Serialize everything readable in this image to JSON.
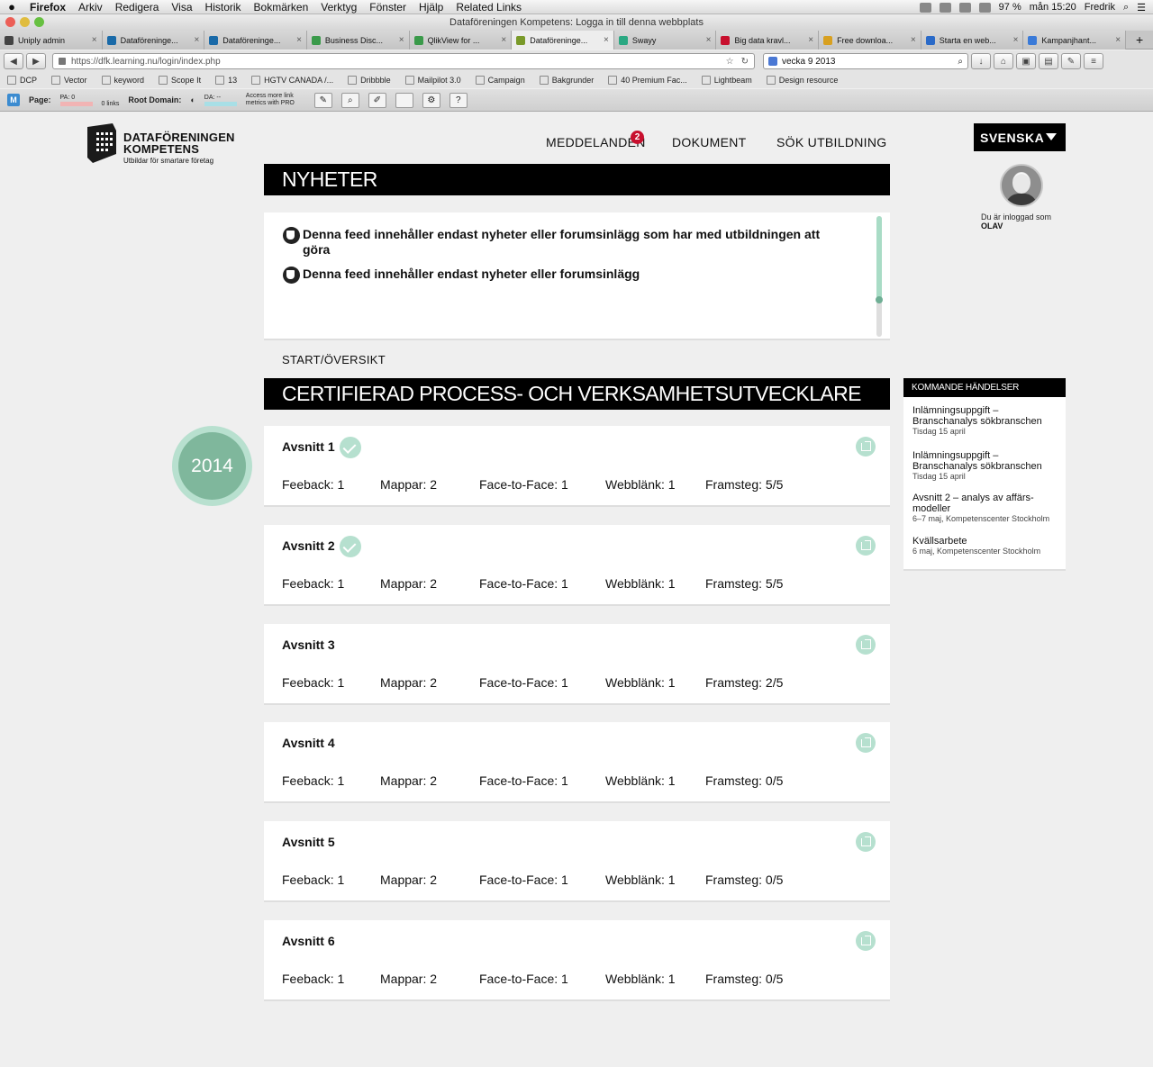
{
  "os_menu": {
    "app": "Firefox",
    "items": [
      "Arkiv",
      "Redigera",
      "Visa",
      "Historik",
      "Bokmärken",
      "Verktyg",
      "Fönster",
      "Hjälp",
      "Related Links"
    ],
    "battery": "97 %",
    "clock": "mån 15:20",
    "user": "Fredrik"
  },
  "window": {
    "title": "Dataföreningen Kompetens: Logga in till denna webbplats"
  },
  "tabs": [
    {
      "label": "Uniply admin",
      "color": "#444444"
    },
    {
      "label": "Dataföreninge...",
      "color": "#1a6aa8"
    },
    {
      "label": "Dataföreninge...",
      "color": "#1a6aa8"
    },
    {
      "label": "Business Disc...",
      "color": "#3a9a4a"
    },
    {
      "label": "QlikView for ...",
      "color": "#3a9a4a"
    },
    {
      "label": "Dataföreninge...",
      "color": "#7a9a2a",
      "active": true
    },
    {
      "label": "Swayy",
      "color": "#2aa882"
    },
    {
      "label": "Big data kravl...",
      "color": "#c8102e"
    },
    {
      "label": "Free downloa...",
      "color": "#d8a020"
    },
    {
      "label": "Starta en web...",
      "color": "#2a6ac8"
    },
    {
      "label": "Kampanjhant...",
      "color": "#3a7ad8"
    }
  ],
  "nav": {
    "url": "https://dfk.learning.nu/login/index.php",
    "search": "vecka 9 2013"
  },
  "bookmarks": [
    "DCP",
    "Vector",
    "keyword",
    "Scope It",
    "13",
    "HGTV CANADA /...",
    "Dribbble",
    "Mailpilot 3.0",
    "Campaign",
    "Bakgrunder",
    "40 Premium Fac...",
    "Lightbeam",
    "Design resource"
  ],
  "mozbar": {
    "page_label": "Page:",
    "pa": "PA: 0",
    "links": "0 links",
    "root_label": "Root Domain:",
    "da": "DA: --",
    "promo": "Access more link metrics with PRO"
  },
  "site": {
    "logo_line1": "DATAFÖRENINGEN",
    "logo_line2": "KOMPETENS",
    "tagline": "Utbildar för smartare företag",
    "nav": {
      "messages": "MEDDELANDEN",
      "messages_badge": "2",
      "documents": "DOKUMENT",
      "search": "SÖK UTBILDNING"
    },
    "language": "SVENSKA",
    "logged_in_text": "Du är inloggad som",
    "username": "OLAV"
  },
  "news": {
    "heading": "NYHETER",
    "items": [
      "Denna feed innehåller endast nyheter eller forumsinlägg som har med utbildningen att göra",
      "Denna feed innehåller endast nyheter eller forumsinlägg"
    ]
  },
  "breadcrumb": "START/ÖVERSIKT",
  "course": {
    "title": "CERTIFIERAD PROCESS- OCH VERKSAMHETSUTVECKLARE",
    "year": "2014",
    "sections": [
      {
        "title": "Avsnitt 1",
        "completed": true,
        "feedback": "Feeback: 1",
        "folders": "Mappar: 2",
        "f2f": "Face-to-Face: 1",
        "weblinks": "Webblänk: 1",
        "progress": "Framsteg: 5/5"
      },
      {
        "title": "Avsnitt 2",
        "completed": true,
        "feedback": "Feeback: 1",
        "folders": "Mappar: 2",
        "f2f": "Face-to-Face: 1",
        "weblinks": "Webblänk: 1",
        "progress": "Framsteg: 5/5"
      },
      {
        "title": "Avsnitt 3",
        "completed": false,
        "feedback": "Feeback: 1",
        "folders": "Mappar: 2",
        "f2f": "Face-to-Face: 1",
        "weblinks": "Webblänk: 1",
        "progress": "Framsteg: 2/5"
      },
      {
        "title": "Avsnitt 4",
        "completed": false,
        "feedback": "Feeback: 1",
        "folders": "Mappar: 2",
        "f2f": "Face-to-Face: 1",
        "weblinks": "Webblänk: 1",
        "progress": "Framsteg: 0/5"
      },
      {
        "title": "Avsnitt 5",
        "completed": false,
        "feedback": "Feeback: 1",
        "folders": "Mappar: 2",
        "f2f": "Face-to-Face: 1",
        "weblinks": "Webblänk: 1",
        "progress": "Framsteg: 0/5"
      },
      {
        "title": "Avsnitt 6",
        "completed": false,
        "feedback": "Feeback: 1",
        "folders": "Mappar: 2",
        "f2f": "Face-to-Face: 1",
        "weblinks": "Webblänk: 1",
        "progress": "Framsteg: 0/5"
      }
    ]
  },
  "events": {
    "heading": "KOMMANDE HÄNDELSER",
    "items": [
      {
        "title": "Inlämningsuppgift – Branschanalys sökbranschen",
        "date": "Tisdag 15 april"
      },
      {
        "title": "Inlämningsuppgift – Branschanalys sökbranschen",
        "date": "Tisdag 15 april"
      },
      {
        "title": "Avsnitt 2 – analys av affärs-modeller",
        "date": "6–7 maj, Kompetenscenter Stockholm"
      },
      {
        "title": "Kvällsarbete",
        "date": "6 maj, Kompetenscenter Stockholm"
      }
    ]
  },
  "colors": {
    "accent_green": "#b6e0cf",
    "year_green": "#7fb79c",
    "badge_red": "#c8102e",
    "header_black": "#000000"
  }
}
